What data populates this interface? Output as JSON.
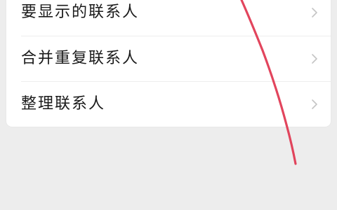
{
  "contacts_settings": {
    "items": [
      {
        "label": "要显示的联系人",
        "icon": "chevron-right-icon"
      },
      {
        "label": "合并重复联系人",
        "icon": "chevron-right-icon"
      },
      {
        "label": "整理联系人",
        "icon": "chevron-right-icon"
      }
    ]
  },
  "colors": {
    "page_background": "#ededed",
    "card_background": "#ffffff",
    "text": "#1a1a1a",
    "chevron": "#c4c4c4",
    "annotation_stroke": "#e0354f"
  }
}
